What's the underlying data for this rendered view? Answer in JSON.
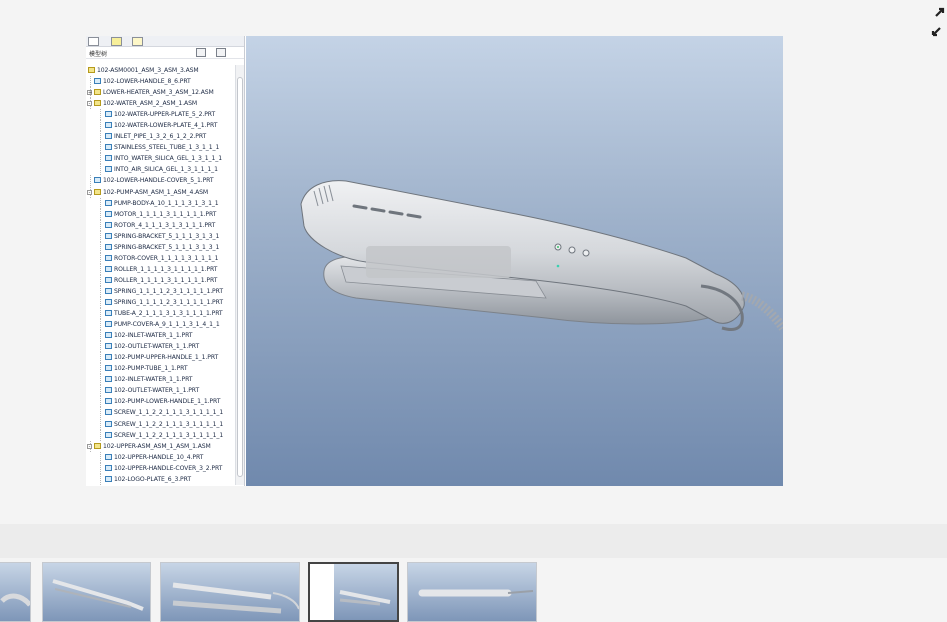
{
  "tree": {
    "title": "模型树",
    "rows": [
      {
        "label": "102-ASM0001_ASM_3_ASM_3.ASM",
        "level": 0,
        "type": "asm",
        "toggle": ""
      },
      {
        "label": "102-LOWER-HANDLE_8_6.PRT",
        "level": 1,
        "type": "prt",
        "toggle": ""
      },
      {
        "label": "LOWER-HEATER_ASM_3_ASM_12.ASM",
        "level": 1,
        "type": "asm",
        "toggle": "+"
      },
      {
        "label": "102-WATER_ASM_2_ASM_1.ASM",
        "level": 1,
        "type": "asm",
        "toggle": "-"
      },
      {
        "label": "102-WATER-UPPER-PLATE_5_2.PRT",
        "level": 2,
        "type": "prt",
        "toggle": ""
      },
      {
        "label": "102-WATER-LOWER-PLATE_4_1.PRT",
        "level": 2,
        "type": "prt",
        "toggle": ""
      },
      {
        "label": "INLET_PIPE_1_3_2_6_1_2_2.PRT",
        "level": 2,
        "type": "prt",
        "toggle": ""
      },
      {
        "label": "STAINLESS_STEEL_TUBE_1_3_1_1_1",
        "level": 2,
        "type": "prt",
        "toggle": ""
      },
      {
        "label": "INTO_WATER_SILICA_GEL_1_3_1_1_1",
        "level": 2,
        "type": "prt",
        "toggle": ""
      },
      {
        "label": "INTO_AIR_SILICA_GEL_1_3_1_1_1_1",
        "level": 2,
        "type": "prt",
        "toggle": ""
      },
      {
        "label": "102-LOWER-HANDLE-COVER_5_1.PRT",
        "level": 1,
        "type": "prt",
        "toggle": ""
      },
      {
        "label": "102-PUMP-ASM_ASM_1_ASM_4.ASM",
        "level": 1,
        "type": "asm",
        "toggle": "-"
      },
      {
        "label": "PUMP-BODY-A_10_1_1_1_3_1_3_1_1",
        "level": 2,
        "type": "prt",
        "toggle": ""
      },
      {
        "label": "MOTOR_1_1_1_1_3_1_1_1_1_1.PRT",
        "level": 2,
        "type": "prt",
        "toggle": ""
      },
      {
        "label": "ROTOR_4_1_1_1_3_1_3_1_1_1.PRT",
        "level": 2,
        "type": "prt",
        "toggle": ""
      },
      {
        "label": "SPRING-BRACKET_5_1_1_1_3_1_3_1",
        "level": 2,
        "type": "prt",
        "toggle": ""
      },
      {
        "label": "SPRING-BRACKET_5_1_1_1_3_1_3_1",
        "level": 2,
        "type": "prt",
        "toggle": ""
      },
      {
        "label": "ROTOR-COVER_1_1_1_1_3_1_1_1_1",
        "level": 2,
        "type": "prt",
        "toggle": ""
      },
      {
        "label": "ROLLER_1_1_1_1_3_1_1_1_1_1.PRT",
        "level": 2,
        "type": "prt",
        "toggle": ""
      },
      {
        "label": "ROLLER_1_1_1_1_3_1_1_1_1_1.PRT",
        "level": 2,
        "type": "prt",
        "toggle": ""
      },
      {
        "label": "SPRING_1_1_1_1_2_3_1_1_1_1_1.PRT",
        "level": 2,
        "type": "prt",
        "toggle": ""
      },
      {
        "label": "SPRING_1_1_1_1_2_3_1_1_1_1_1.PRT",
        "level": 2,
        "type": "prt",
        "toggle": ""
      },
      {
        "label": "TUBE-A_2_1_1_1_3_1_3_1_1_1_1.PRT",
        "level": 2,
        "type": "prt",
        "toggle": ""
      },
      {
        "label": "PUMP-COVER-A_9_1_1_1_3_1_4_1_1",
        "level": 2,
        "type": "prt",
        "toggle": ""
      },
      {
        "label": "102-INLET-WATER_1_1.PRT",
        "level": 2,
        "type": "prt",
        "toggle": ""
      },
      {
        "label": "102-OUTLET-WATER_1_1.PRT",
        "level": 2,
        "type": "prt",
        "toggle": ""
      },
      {
        "label": "102-PUMP-UPPER-HANDLE_1_1.PRT",
        "level": 2,
        "type": "prt",
        "toggle": ""
      },
      {
        "label": "102-PUMP-TUBE_1_1.PRT",
        "level": 2,
        "type": "prt",
        "toggle": ""
      },
      {
        "label": "102-INLET-WATER_1_1.PRT",
        "level": 2,
        "type": "prt",
        "toggle": ""
      },
      {
        "label": "102-OUTLET-WATER_1_1.PRT",
        "level": 2,
        "type": "prt",
        "toggle": ""
      },
      {
        "label": "102-PUMP-LOWER-HANDLE_1_1.PRT",
        "level": 2,
        "type": "prt",
        "toggle": ""
      },
      {
        "label": "SCREW_1_1_2_2_1_1_1_3_1_1_1_1_1",
        "level": 2,
        "type": "prt",
        "toggle": ""
      },
      {
        "label": "SCREW_1_1_2_2_1_1_1_3_1_1_1_1_1",
        "level": 2,
        "type": "prt",
        "toggle": ""
      },
      {
        "label": "SCREW_1_1_2_2_1_1_1_3_1_1_1_1_1",
        "level": 2,
        "type": "prt",
        "toggle": ""
      },
      {
        "label": "102-UPPER-ASM_ASM_1_ASM_1.ASM",
        "level": 1,
        "type": "asm",
        "toggle": "-"
      },
      {
        "label": "102-UPPER-HANDLE_10_4.PRT",
        "level": 2,
        "type": "prt",
        "toggle": ""
      },
      {
        "label": "102-UPPER-HANDLE-COVER_3_2.PRT",
        "level": 2,
        "type": "prt",
        "toggle": ""
      },
      {
        "label": "102-LOGO-PLATE_6_3.PRT",
        "level": 2,
        "type": "prt",
        "toggle": ""
      }
    ]
  },
  "gallery": {
    "thumbnails": [
      {
        "name": "thumbnail-1",
        "active": false
      },
      {
        "name": "thumbnail-2",
        "active": false
      },
      {
        "name": "thumbnail-3",
        "active": false
      },
      {
        "name": "thumbnail-4",
        "active": true
      },
      {
        "name": "thumbnail-5",
        "active": false
      }
    ]
  },
  "colors": {
    "viewport_top": "#c4d3e6",
    "viewport_bottom": "#7089ad",
    "model": "#d4d6d9",
    "active_thumb_border": "#444444"
  },
  "icons": {
    "expand": "expand-arrows-icon"
  }
}
